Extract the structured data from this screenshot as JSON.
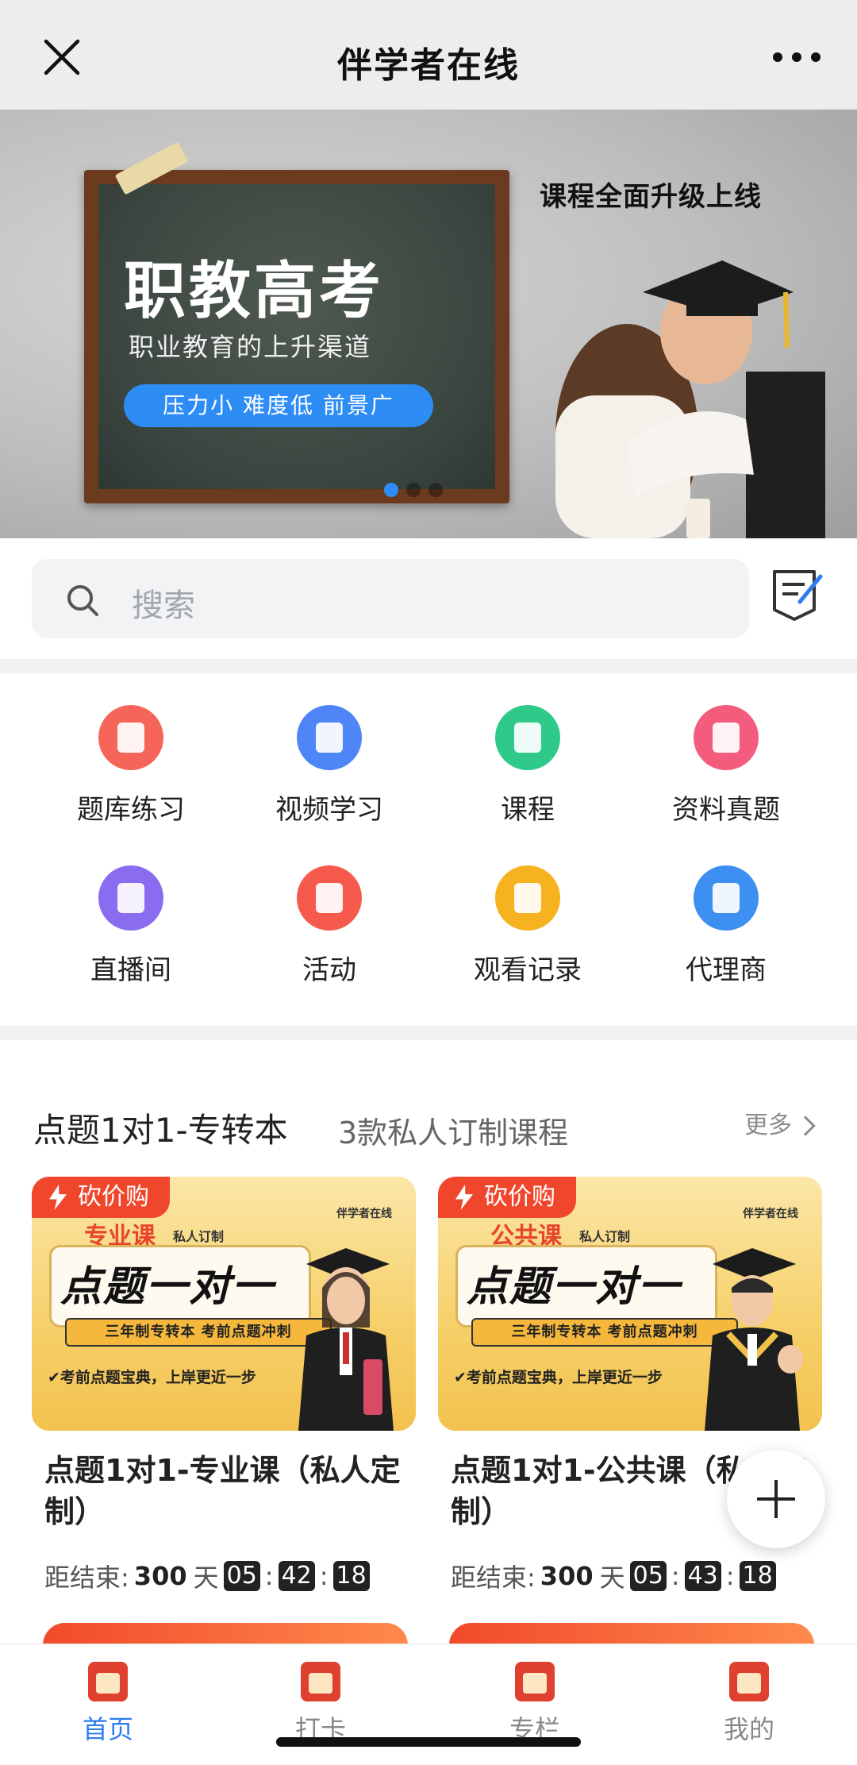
{
  "header": {
    "title": "伴学者在线"
  },
  "banner": {
    "slogan": "课程全面升级上线",
    "headline": "职教高考",
    "subtitle": "职业教育的上升渠道",
    "pill": "压力小 难度低 前景广",
    "active_dot": 1,
    "dot_count": 3
  },
  "search": {
    "placeholder": "搜索"
  },
  "grid": {
    "items": [
      {
        "label": "题库练习",
        "icon": "question-bank-icon",
        "color": "#f5655a"
      },
      {
        "label": "视频学习",
        "icon": "video-icon",
        "color": "#4f86f7"
      },
      {
        "label": "课程",
        "icon": "course-icon",
        "color": "#2fc98a"
      },
      {
        "label": "资料真题",
        "icon": "folder-icon",
        "color": "#f35c7d"
      },
      {
        "label": "直播间",
        "icon": "live-tv-icon",
        "color": "#8a6cf0"
      },
      {
        "label": "活动",
        "icon": "flame-icon",
        "color": "#f65a4c"
      },
      {
        "label": "观看记录",
        "icon": "history-icon",
        "color": "#f7b21f"
      },
      {
        "label": "代理商",
        "icon": "agent-icon",
        "color": "#3e8ff2"
      }
    ]
  },
  "section": {
    "title": "点题1对1-专转本",
    "subtitle": "3款私人订制课程",
    "more": "更多",
    "cards": [
      {
        "tag": "砍价购",
        "kind": "专业课",
        "custom": "私人订制",
        "brand": "伴学者在线",
        "big": "点题一对一",
        "ribbon": "三年制专转本 考前点题冲刺",
        "bottomline": "✔考前点题宝典，上岸更近一步",
        "title": "点题1对1-专业课（私人定制）",
        "countdown_label": "距结束:",
        "days": "300",
        "day_unit": "天",
        "hh": "05",
        "mm": "42",
        "ss": "18",
        "person_color": "#c9332e"
      },
      {
        "tag": "砍价购",
        "kind": "公共课",
        "custom": "私人订制",
        "brand": "伴学者在线",
        "big": "点题一对一",
        "ribbon": "三年制专转本 考前点题冲刺",
        "bottomline": "✔考前点题宝典，上岸更近一步",
        "title": "点题1对1-公共课（私人定制）",
        "countdown_label": "距结束:",
        "days": "300",
        "day_unit": "天",
        "hh": "05",
        "mm": "43",
        "ss": "18",
        "person_color": "#333333"
      }
    ]
  },
  "tabbar": {
    "tabs": [
      {
        "label": "首页",
        "active": true
      },
      {
        "label": "打卡",
        "active": false
      },
      {
        "label": "专栏",
        "active": false
      },
      {
        "label": "我的",
        "active": false
      }
    ]
  },
  "colors": {
    "accent": "#2d7cf0",
    "brand_red": "#f0462c"
  }
}
